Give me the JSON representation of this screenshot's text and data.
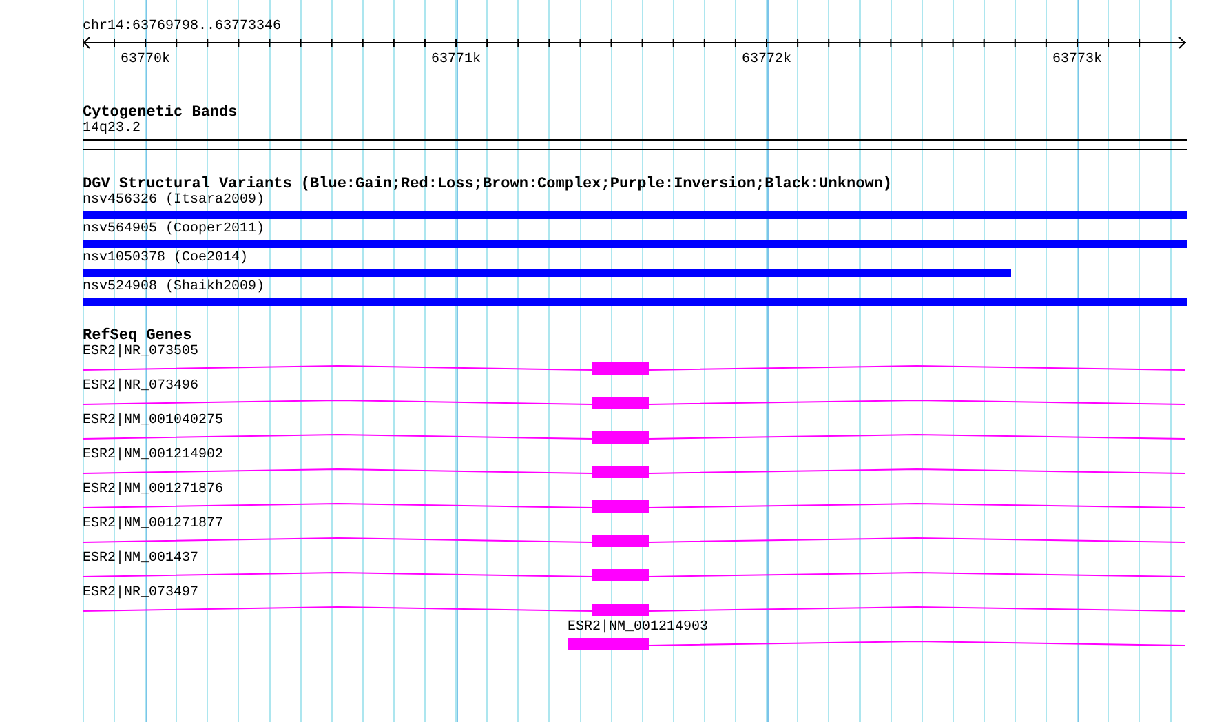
{
  "ruler": {
    "position": "chr14:63769798..63773346",
    "ticks": [
      "63770k",
      "63771k",
      "63772k",
      "63773k"
    ]
  },
  "cytobands": {
    "title": "Cytogenetic Bands",
    "band": "14q23.2"
  },
  "variants": {
    "title": "DGV Structural Variants (Blue:Gain;Red:Loss;Brown:Complex;Purple:Inversion;Black:Unknown)",
    "items": [
      {
        "label": "nsv456326 (Itsara2009)",
        "color": "#0000ff",
        "level": 1
      },
      {
        "label": "nsv564905 (Cooper2011)",
        "color": "#0000ff",
        "level": 1
      },
      {
        "label": "nsv1050378 (Coe2014)",
        "color": "#0000ff",
        "level": 0.84
      },
      {
        "label": "nsv524908 (Shaikh2009)",
        "color": "#0000ff",
        "level": 1
      }
    ]
  },
  "genes": {
    "title": "RefSeq Genes",
    "items": [
      {
        "label": "ESR2|NR_073505",
        "kind": "spanning"
      },
      {
        "label": "ESR2|NR_073496",
        "kind": "spanning"
      },
      {
        "label": "ESR2|NM_001040275",
        "kind": "spanning"
      },
      {
        "label": "ESR2|NM_001214902",
        "kind": "spanning"
      },
      {
        "label": "ESR2|NM_001271876",
        "kind": "spanning"
      },
      {
        "label": "ESR2|NM_001271877",
        "kind": "spanning"
      },
      {
        "label": "ESR2|NM_001437",
        "kind": "spanning"
      },
      {
        "label": "ESR2|NR_073497",
        "kind": "spanning"
      },
      {
        "label": "ESR2|NM_001214903",
        "kind": "starting"
      }
    ]
  }
}
